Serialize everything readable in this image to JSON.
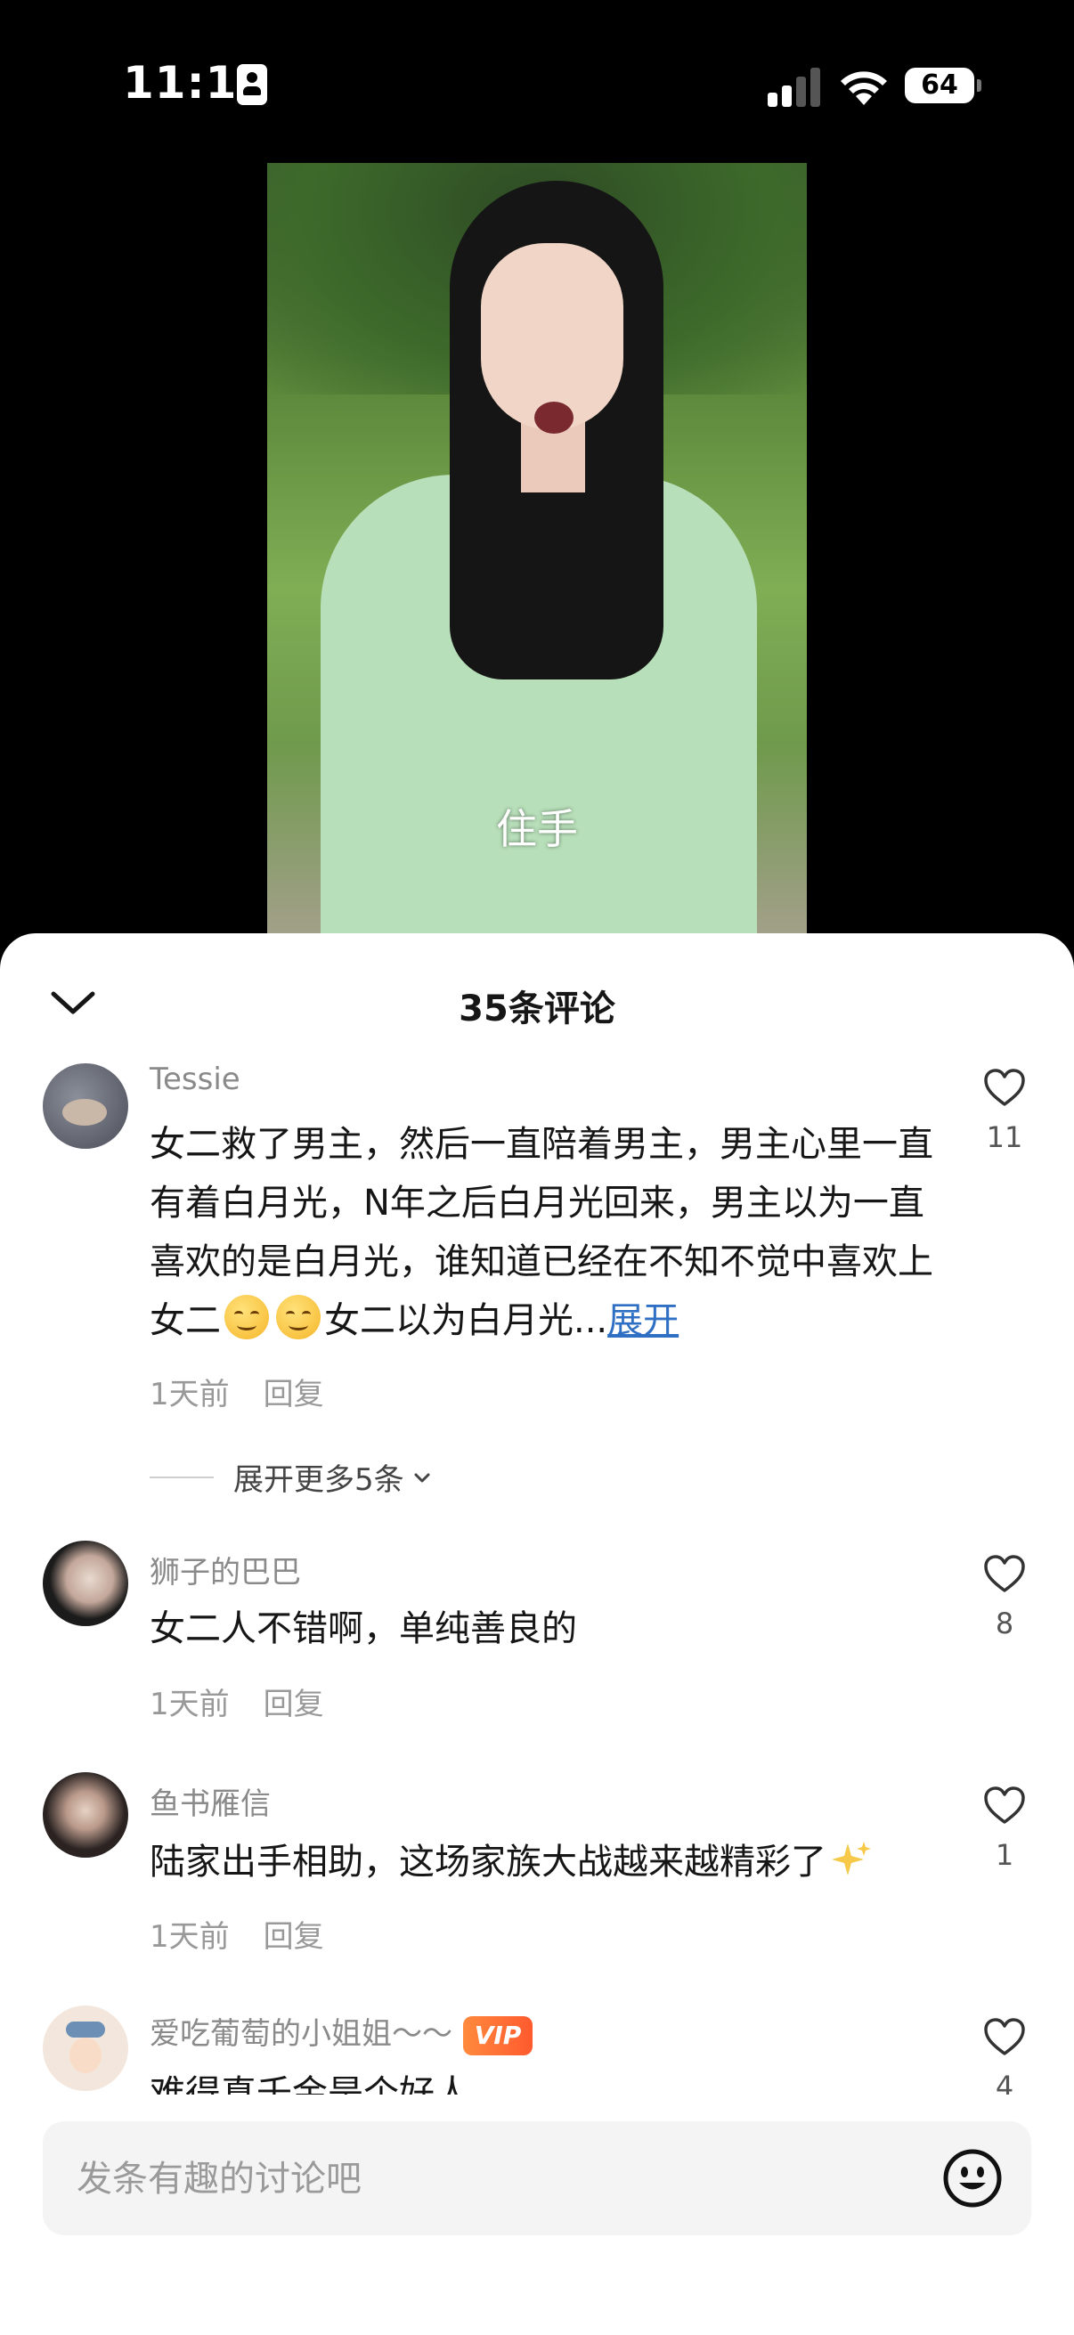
{
  "status_bar": {
    "time": "11:12",
    "battery": "64"
  },
  "video": {
    "subtitle": "住手"
  },
  "comments_panel": {
    "title": "35条评论",
    "comments": [
      {
        "username": "Tessie",
        "text_part1": "女二救了男主，然后一直陪着男主，男主心里一直有着白月光，N年之后白月光回来，男主以为一直喜欢的是白月光，谁知道已经在不知不觉中喜欢上女二",
        "text_part2": "女二以为白月光...",
        "expand": "展开",
        "time": "1天前",
        "reply": "回复",
        "likes": "11"
      },
      {
        "username": "狮子的巴巴",
        "text": "女二人不错啊，单纯善良的",
        "time": "1天前",
        "reply": "回复",
        "likes": "8"
      },
      {
        "username": "鱼书雁信",
        "text": "陆家出手相助，这场家族大战越来越精彩了",
        "time": "1天前",
        "reply": "回复",
        "likes": "1"
      },
      {
        "username": "爱吃葡萄的小姐姐～～",
        "badge": "VIP",
        "text": "难得真千金是个好人",
        "likes": "4"
      }
    ],
    "more_replies": "展开更多5条"
  },
  "input": {
    "placeholder": "发条有趣的讨论吧"
  }
}
